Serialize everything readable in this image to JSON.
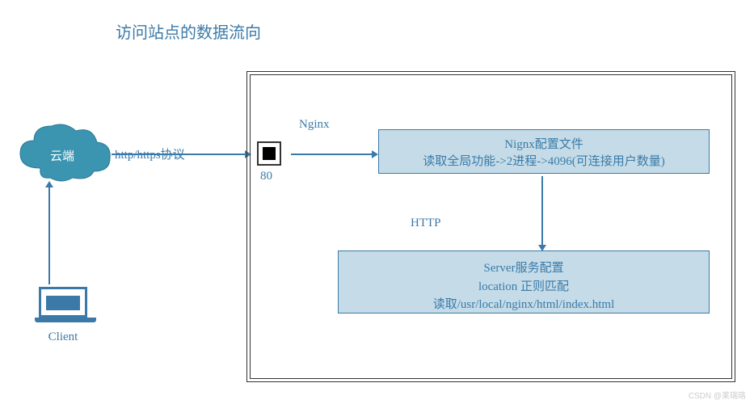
{
  "title": "访问站点的数据流向",
  "cloud": {
    "label": "云端"
  },
  "client": {
    "label": "Client"
  },
  "protocol": "http/https协议",
  "nginx": {
    "label": "Nginx",
    "port": "80"
  },
  "box1": {
    "line1": "Nignx配置文件",
    "line2": "读取全局功能->2进程->4096(可连接用户数量)"
  },
  "http_label": "HTTP",
  "box2": {
    "line1": "Server服务配置",
    "line2": "location 正则匹配",
    "line3": "读取/usr/local/nginx/html/index.html"
  },
  "watermark": "CSDN @莱瑞珞"
}
